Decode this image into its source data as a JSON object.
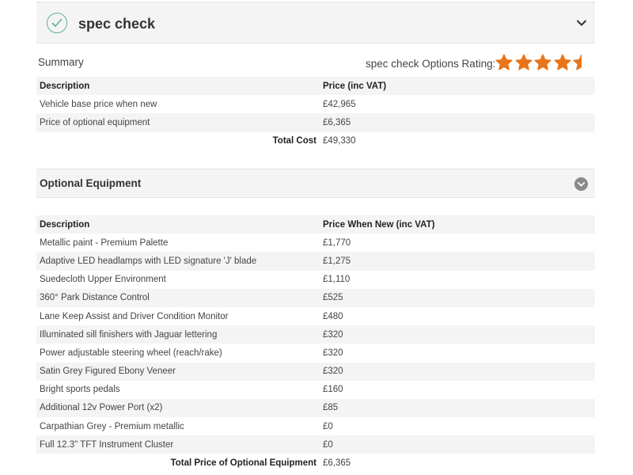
{
  "header": {
    "title": "spec check"
  },
  "summary": {
    "label": "Summary",
    "rating_label": "spec check Options Rating:",
    "rating_value": 4.5,
    "rating_max": 5,
    "col_description": "Description",
    "col_price": "Price (inc VAT)",
    "rows": [
      {
        "description": "Vehicle base price when new",
        "price": "£42,965"
      },
      {
        "description": "Price of optional equipment",
        "price": "£6,365"
      }
    ],
    "total_label": "Total Cost",
    "total_value": "£49,330"
  },
  "optional": {
    "title": "Optional Equipment",
    "col_description": "Description",
    "col_price": "Price When New (inc VAT)",
    "rows": [
      {
        "description": "Metallic paint - Premium Palette",
        "price": "£1,770"
      },
      {
        "description": "Adaptive LED headlamps with LED signature 'J' blade",
        "price": "£1,275"
      },
      {
        "description": "Suedecloth Upper Environment",
        "price": "£1,110"
      },
      {
        "description": "360° Park Distance Control",
        "price": "£525"
      },
      {
        "description": "Lane Keep Assist and Driver Condition Monitor",
        "price": "£480"
      },
      {
        "description": "Illuminated sill finishers with Jaguar lettering",
        "price": "£320"
      },
      {
        "description": "Power adjustable steering wheel (reach/rake)",
        "price": "£320"
      },
      {
        "description": "Satin Grey Figured Ebony Veneer",
        "price": "£320"
      },
      {
        "description": "Bright sports pedals",
        "price": "£160"
      },
      {
        "description": "Additional 12v Power Port (x2)",
        "price": "£85"
      },
      {
        "description": "Carpathian Grey - Premium metallic",
        "price": "£0"
      },
      {
        "description": "Full 12.3\" TFT Instrument Cluster",
        "price": "£0"
      }
    ],
    "total_label": "Total Price of Optional Equipment",
    "total_value": "£6,365"
  },
  "colors": {
    "accent_star": "#e8751a",
    "check_green": "#5fb38f",
    "panel_bg": "#f4f4f4"
  },
  "icons": {
    "check": "check-circle-icon",
    "chevron": "chevron-down-icon",
    "circle_chevron": "circle-chevron-down-icon",
    "star": "star-icon"
  }
}
